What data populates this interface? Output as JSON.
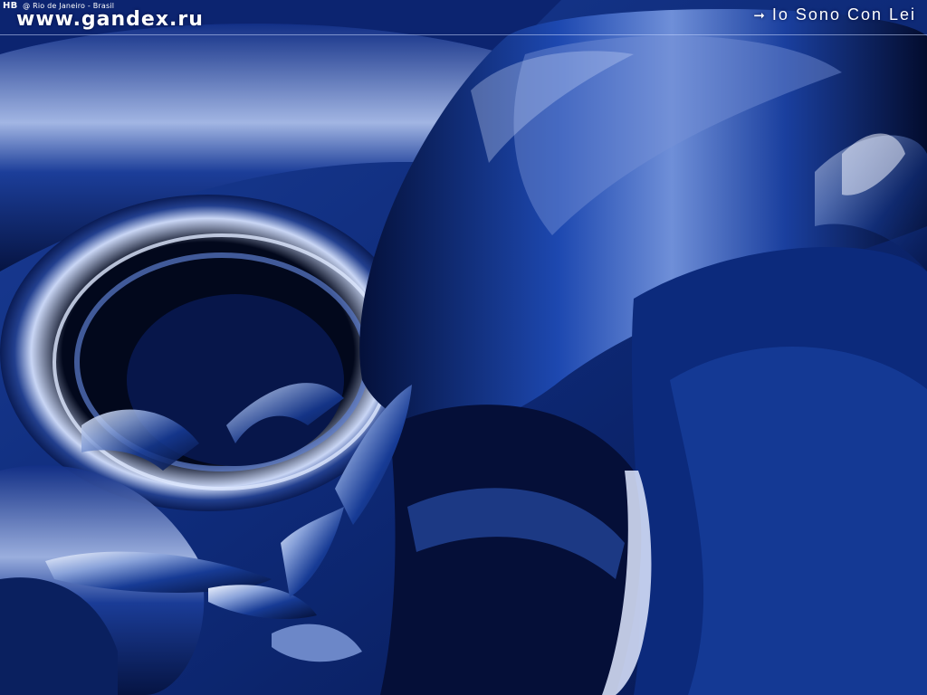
{
  "header": {
    "monogram": "HB",
    "credit_prefix": "@",
    "credit_location": "Rio de Janeiro - Brasil",
    "site_url": "www.gandex.ru",
    "title_arrow_icon": "arrow-right-icon",
    "title": "Io Sono Con Lei"
  },
  "colors": {
    "deep_blue": "#0d2a78",
    "mid_blue": "#1e4aa8",
    "highlight": "#dfe8ff",
    "shadow": "#020818"
  }
}
